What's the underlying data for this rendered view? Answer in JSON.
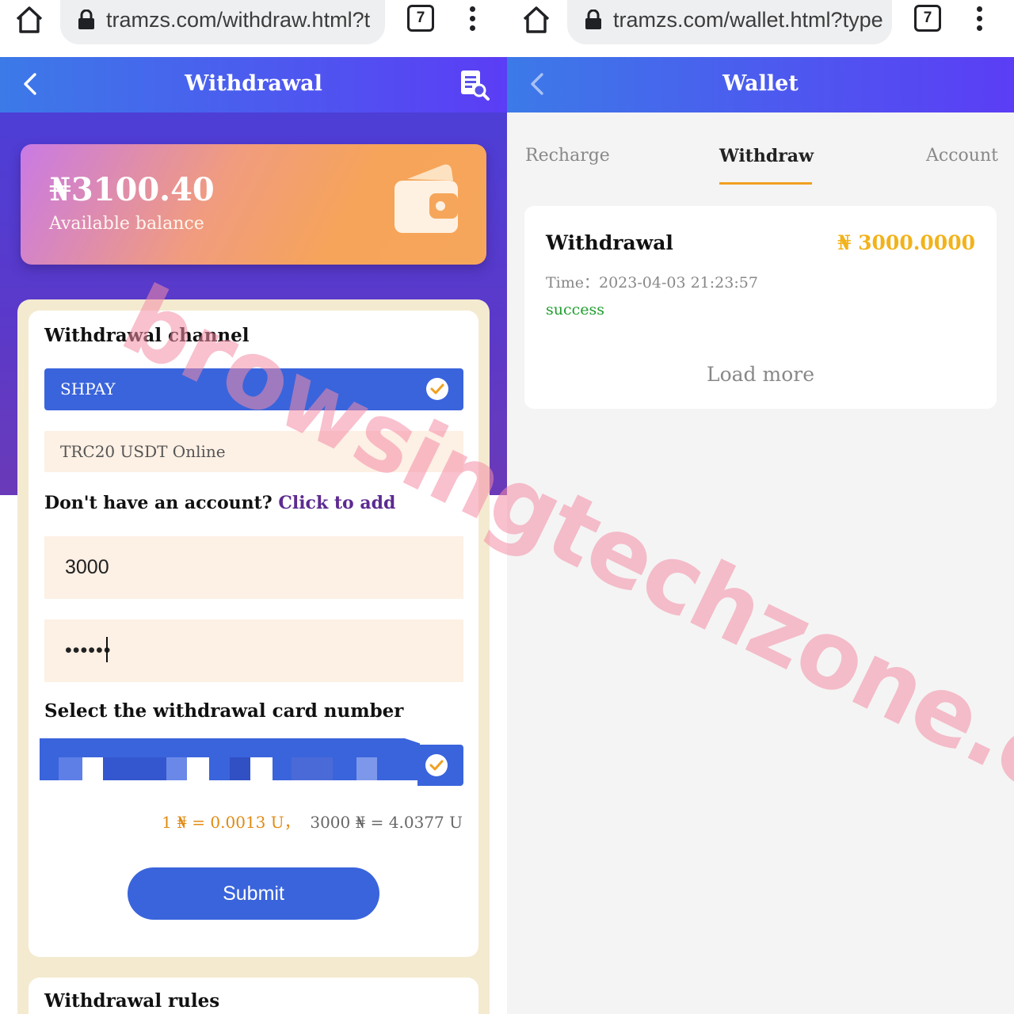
{
  "left_browser": {
    "url": "tramzs.com/withdraw.html?t",
    "tab_count": "7"
  },
  "right_browser": {
    "url": "tramzs.com/wallet.html?type",
    "tab_count": "7"
  },
  "withdraw_page": {
    "header_title": "Withdrawal",
    "balance_amount": "₦3100.40",
    "balance_label": "Available balance",
    "channel_title": "Withdrawal channel",
    "channels": [
      {
        "label": "SHPAY",
        "selected": true
      },
      {
        "label": "TRC20 USDT Online",
        "selected": false
      }
    ],
    "account_prompt": "Don't have an account? ",
    "add_link": "Click to add",
    "amount_value": "3000",
    "password_value": "••••••",
    "card_title": "Select the withdrawal card number",
    "rate_primary": "1 ₦ = 0.0013 U，",
    "rate_secondary": "3000 ₦ = 4.0377 U",
    "submit_label": "Submit",
    "rules_title": "Withdrawal rules"
  },
  "wallet_page": {
    "header_title": "Wallet",
    "tabs": [
      {
        "label": "Recharge",
        "active": false
      },
      {
        "label": "Withdraw",
        "active": true
      },
      {
        "label": "Account",
        "active": false
      }
    ],
    "record": {
      "type": "Withdrawal",
      "amount": "₦ 3000.0000",
      "time": "Time：2023-04-03 21:23:57",
      "status": "success"
    },
    "load_more": "Load more"
  },
  "watermark": "browsingtechzone.com",
  "colors": {
    "header_gradient_start": "#3c7ae8",
    "header_gradient_end": "#5b3df5",
    "primary_blue": "#3a64dc",
    "accent_gold": "#f2b21a",
    "tab_underline": "#f0a021",
    "success_green": "#1f9e2e",
    "link_purple": "#5d2a91"
  },
  "icons": {
    "home": "home-icon",
    "lock": "lock-icon",
    "menu": "more-vert-icon",
    "back": "chevron-left-icon",
    "record": "document-search-icon",
    "wallet": "wallet-icon",
    "check": "check-circle-icon"
  }
}
